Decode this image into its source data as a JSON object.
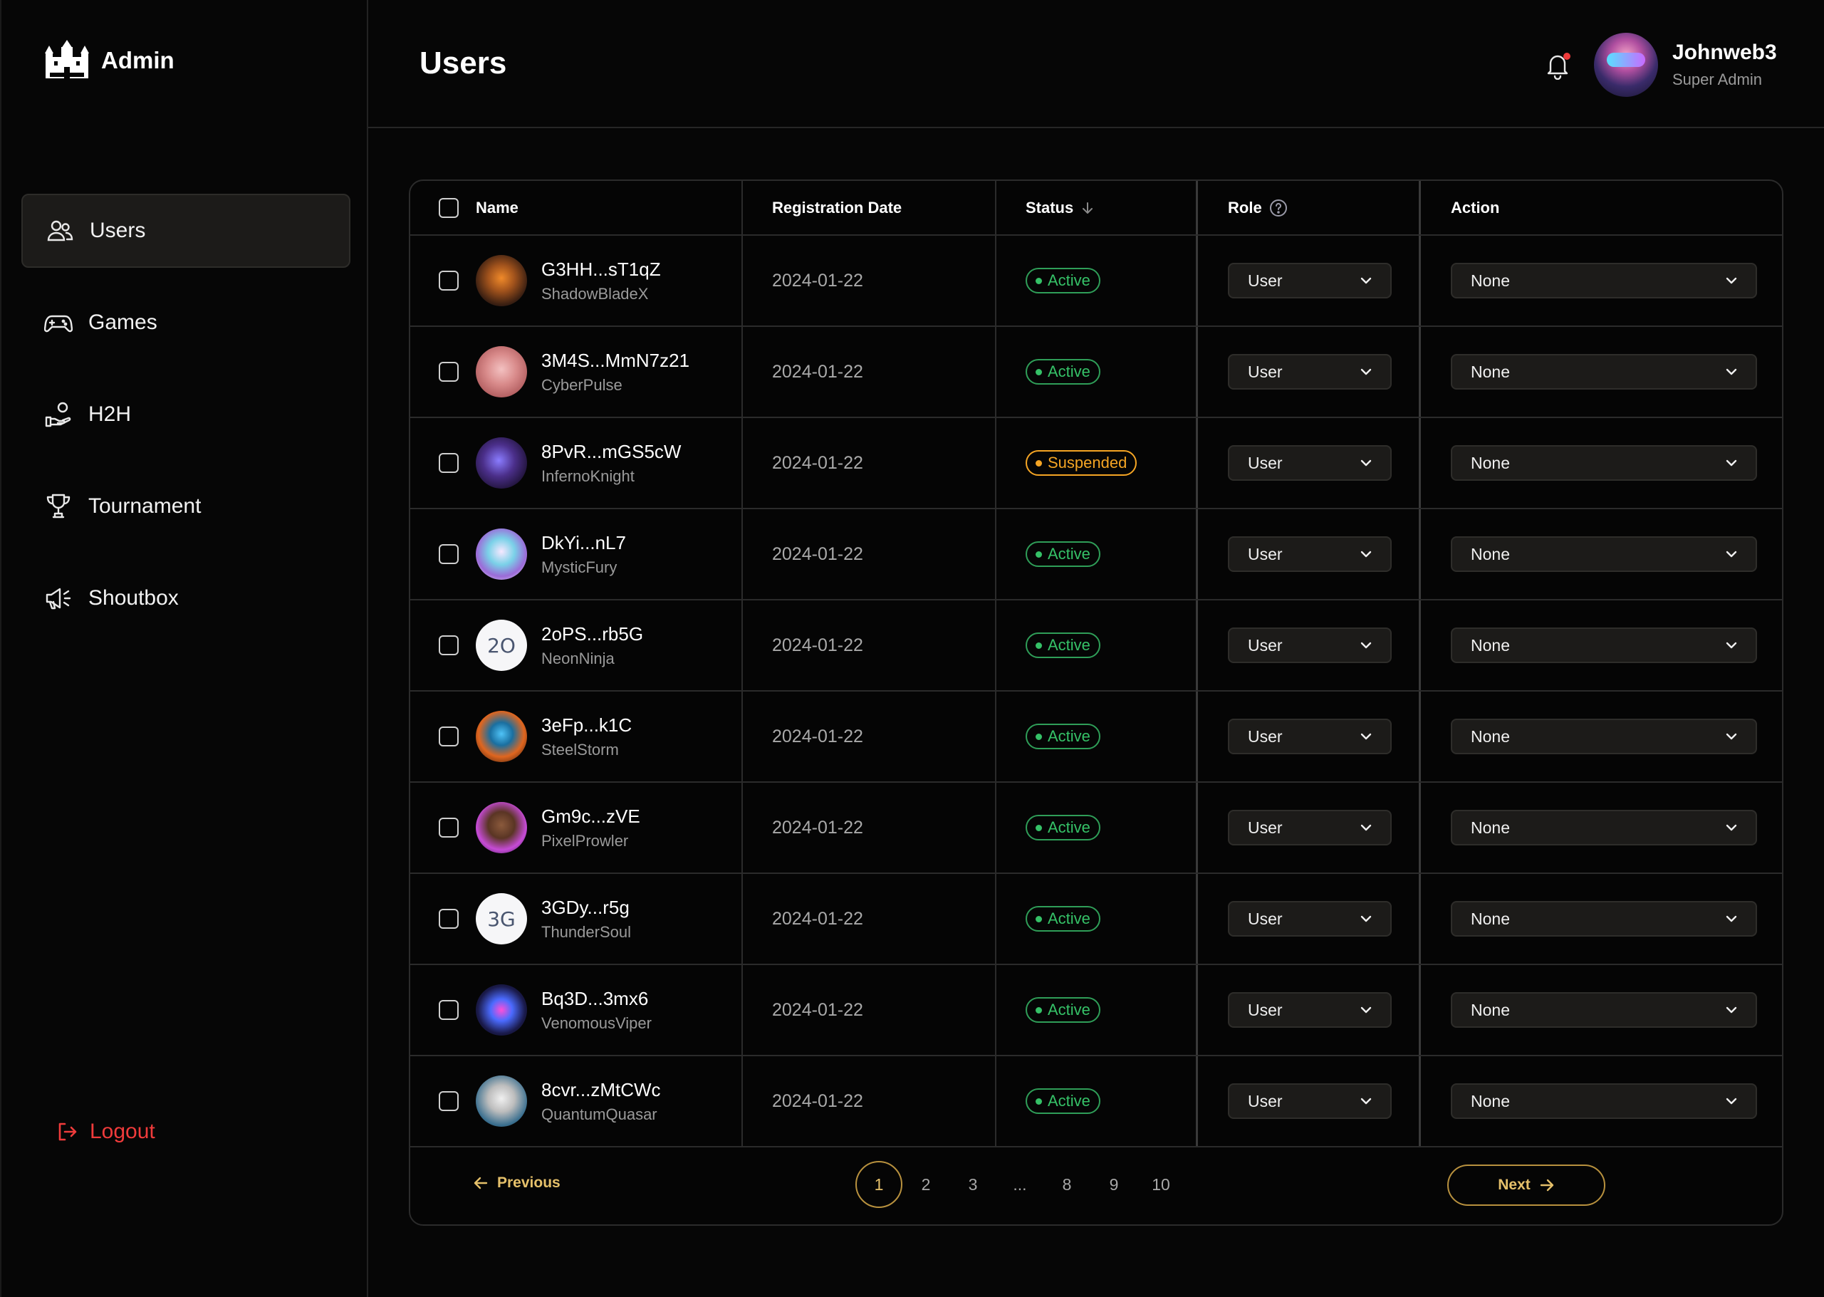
{
  "app": {
    "title": "Admin"
  },
  "sidebar": {
    "items": [
      {
        "label": "Users",
        "icon": "users-icon",
        "active": true
      },
      {
        "label": "Games",
        "icon": "gamepad-icon",
        "active": false
      },
      {
        "label": "H2H",
        "icon": "hand-coin-icon",
        "active": false
      },
      {
        "label": "Tournament",
        "icon": "trophy-icon",
        "active": false
      },
      {
        "label": "Shoutbox",
        "icon": "megaphone-icon",
        "active": false
      }
    ],
    "logout_label": "Logout"
  },
  "header": {
    "page_title": "Users",
    "user_name": "Johnweb3",
    "user_role": "Super Admin"
  },
  "table": {
    "columns": {
      "name": "Name",
      "registration_date": "Registration Date",
      "status": "Status",
      "role": "Role",
      "action": "Action"
    },
    "rows": [
      {
        "wallet": "G3HH...sT1qZ",
        "username": "ShadowBladeX",
        "date": "2024-01-22",
        "status": "Active",
        "role": "User",
        "action": "None",
        "avatar_initials": ""
      },
      {
        "wallet": "3M4S...MmN7z21",
        "username": "CyberPulse",
        "date": "2024-01-22",
        "status": "Active",
        "role": "User",
        "action": "None",
        "avatar_initials": ""
      },
      {
        "wallet": "8PvR...mGS5cW",
        "username": "InfernoKnight",
        "date": "2024-01-22",
        "status": "Suspended",
        "role": "User",
        "action": "None",
        "avatar_initials": ""
      },
      {
        "wallet": "DkYi...nL7",
        "username": "MysticFury",
        "date": "2024-01-22",
        "status": "Active",
        "role": "User",
        "action": "None",
        "avatar_initials": ""
      },
      {
        "wallet": "2oPS...rb5G",
        "username": "NeonNinja",
        "date": "2024-01-22",
        "status": "Active",
        "role": "User",
        "action": "None",
        "avatar_initials": "2O"
      },
      {
        "wallet": "3eFp...k1C",
        "username": "SteelStorm",
        "date": "2024-01-22",
        "status": "Active",
        "role": "User",
        "action": "None",
        "avatar_initials": ""
      },
      {
        "wallet": "Gm9c...zVE",
        "username": "PixelProwler",
        "date": "2024-01-22",
        "status": "Active",
        "role": "User",
        "action": "None",
        "avatar_initials": ""
      },
      {
        "wallet": "3GDy...r5g",
        "username": "ThunderSoul",
        "date": "2024-01-22",
        "status": "Active",
        "role": "User",
        "action": "None",
        "avatar_initials": "3G"
      },
      {
        "wallet": "Bq3D...3mx6",
        "username": "VenomousViper",
        "date": "2024-01-22",
        "status": "Active",
        "role": "User",
        "action": "None",
        "avatar_initials": ""
      },
      {
        "wallet": "8cvr...zMtCWc",
        "username": "QuantumQuasar",
        "date": "2024-01-22",
        "status": "Active",
        "role": "User",
        "action": "None",
        "avatar_initials": ""
      }
    ]
  },
  "pagination": {
    "prev_label": "Previous",
    "next_label": "Next",
    "pages": [
      "1",
      "2",
      "3",
      "...",
      "8",
      "9",
      "10"
    ],
    "current": "1"
  },
  "colors": {
    "accent_gold": "#e5c06a",
    "active_green": "#35c167",
    "suspended_orange": "#f5a524",
    "logout_red": "#ef3b3b"
  }
}
